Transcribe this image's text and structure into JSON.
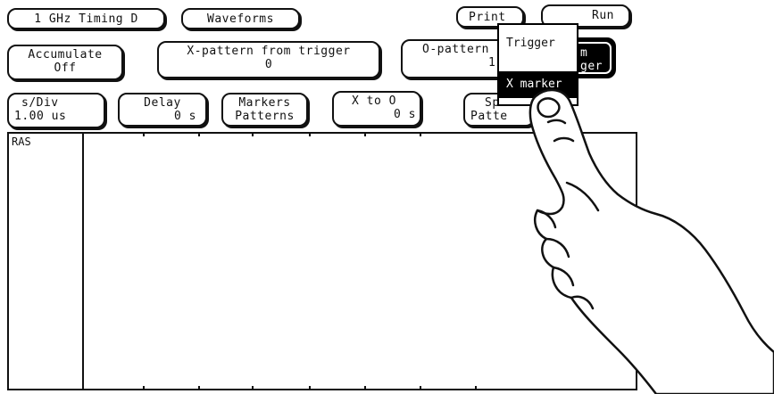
{
  "toolbar": {
    "analyzer_label": "1 GHz Timing D",
    "waveforms_label": "Waveforms",
    "print_label": "Print",
    "run_label": "Run"
  },
  "row2": {
    "accumulate": {
      "title": "Accumulate",
      "value": "Off"
    },
    "x_pattern": {
      "title": "X-pattern from trigger",
      "value": "0"
    },
    "o_pattern": {
      "title": "O-pattern",
      "value": "1"
    },
    "dark_button": {
      "line1": "m",
      "line2": "ger"
    }
  },
  "row3": {
    "sdiv": {
      "title": "s/Div",
      "value": "1.00 us"
    },
    "delay": {
      "title": "Delay",
      "value": "0  s"
    },
    "markers": {
      "title": "Markers",
      "value": "Patterns"
    },
    "x_to_o": {
      "title": "X to O",
      "value": "0  s"
    },
    "partial": {
      "title": "Sp",
      "value": "Patte"
    }
  },
  "popup": {
    "options": [
      "Trigger",
      "X marker"
    ],
    "selected": "X marker"
  },
  "plot": {
    "channels": [
      "RAS"
    ]
  }
}
